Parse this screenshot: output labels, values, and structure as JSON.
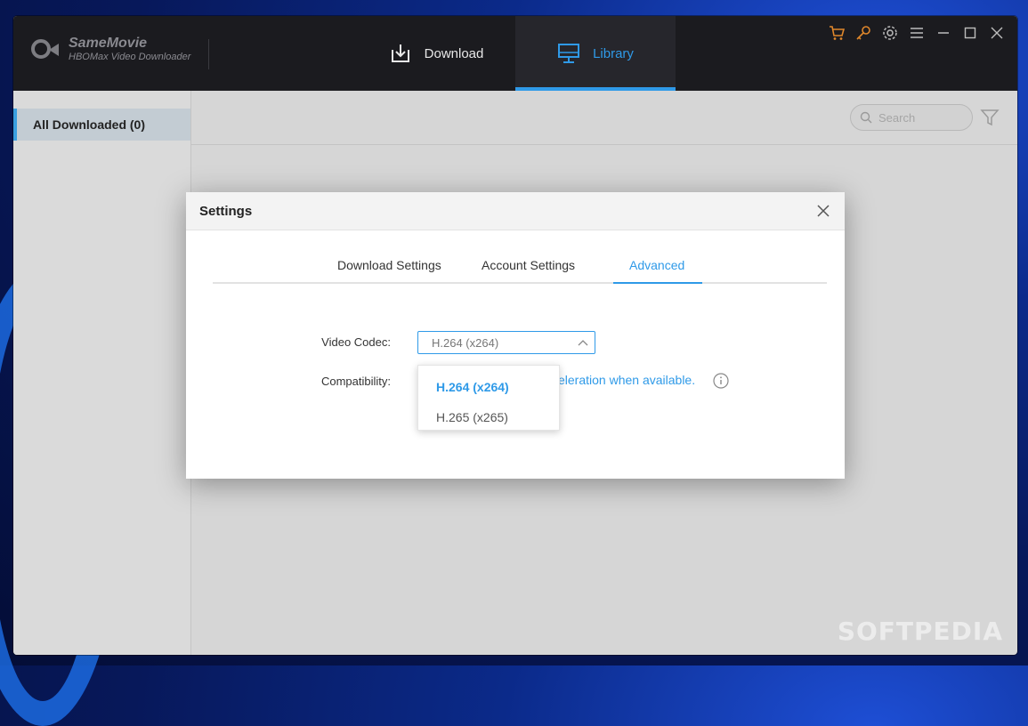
{
  "app": {
    "name": "SameMovie",
    "subtitle": "HBOMax Video Downloader"
  },
  "nav": {
    "download_label": "Download",
    "library_label": "Library"
  },
  "toolbar_icons": [
    "cart-icon",
    "key-icon",
    "gear-icon",
    "menu-icon",
    "minimize-icon",
    "maximize-icon",
    "close-icon"
  ],
  "sidebar": {
    "items": [
      {
        "label": "All Downloaded (0)"
      }
    ]
  },
  "search": {
    "placeholder": "Search"
  },
  "settings_dialog": {
    "title": "Settings",
    "tabs": [
      {
        "label": "Download Settings"
      },
      {
        "label": "Account Settings"
      },
      {
        "label": "Advanced"
      }
    ],
    "video_codec_label": "Video Codec:",
    "video_codec_value": "H.264 (x264)",
    "compatibility_label": "Compatibility:",
    "compatibility_text": "eleration when available.",
    "codec_options": [
      {
        "label": "H.264 (x264)"
      },
      {
        "label": "H.265 (x265)"
      }
    ]
  },
  "colors": {
    "accent": "#2f9ae8",
    "titlebar": "#1b1b1f",
    "toolbar_icon_orange": "#e0872b"
  },
  "watermark": "SOFTPEDIA"
}
